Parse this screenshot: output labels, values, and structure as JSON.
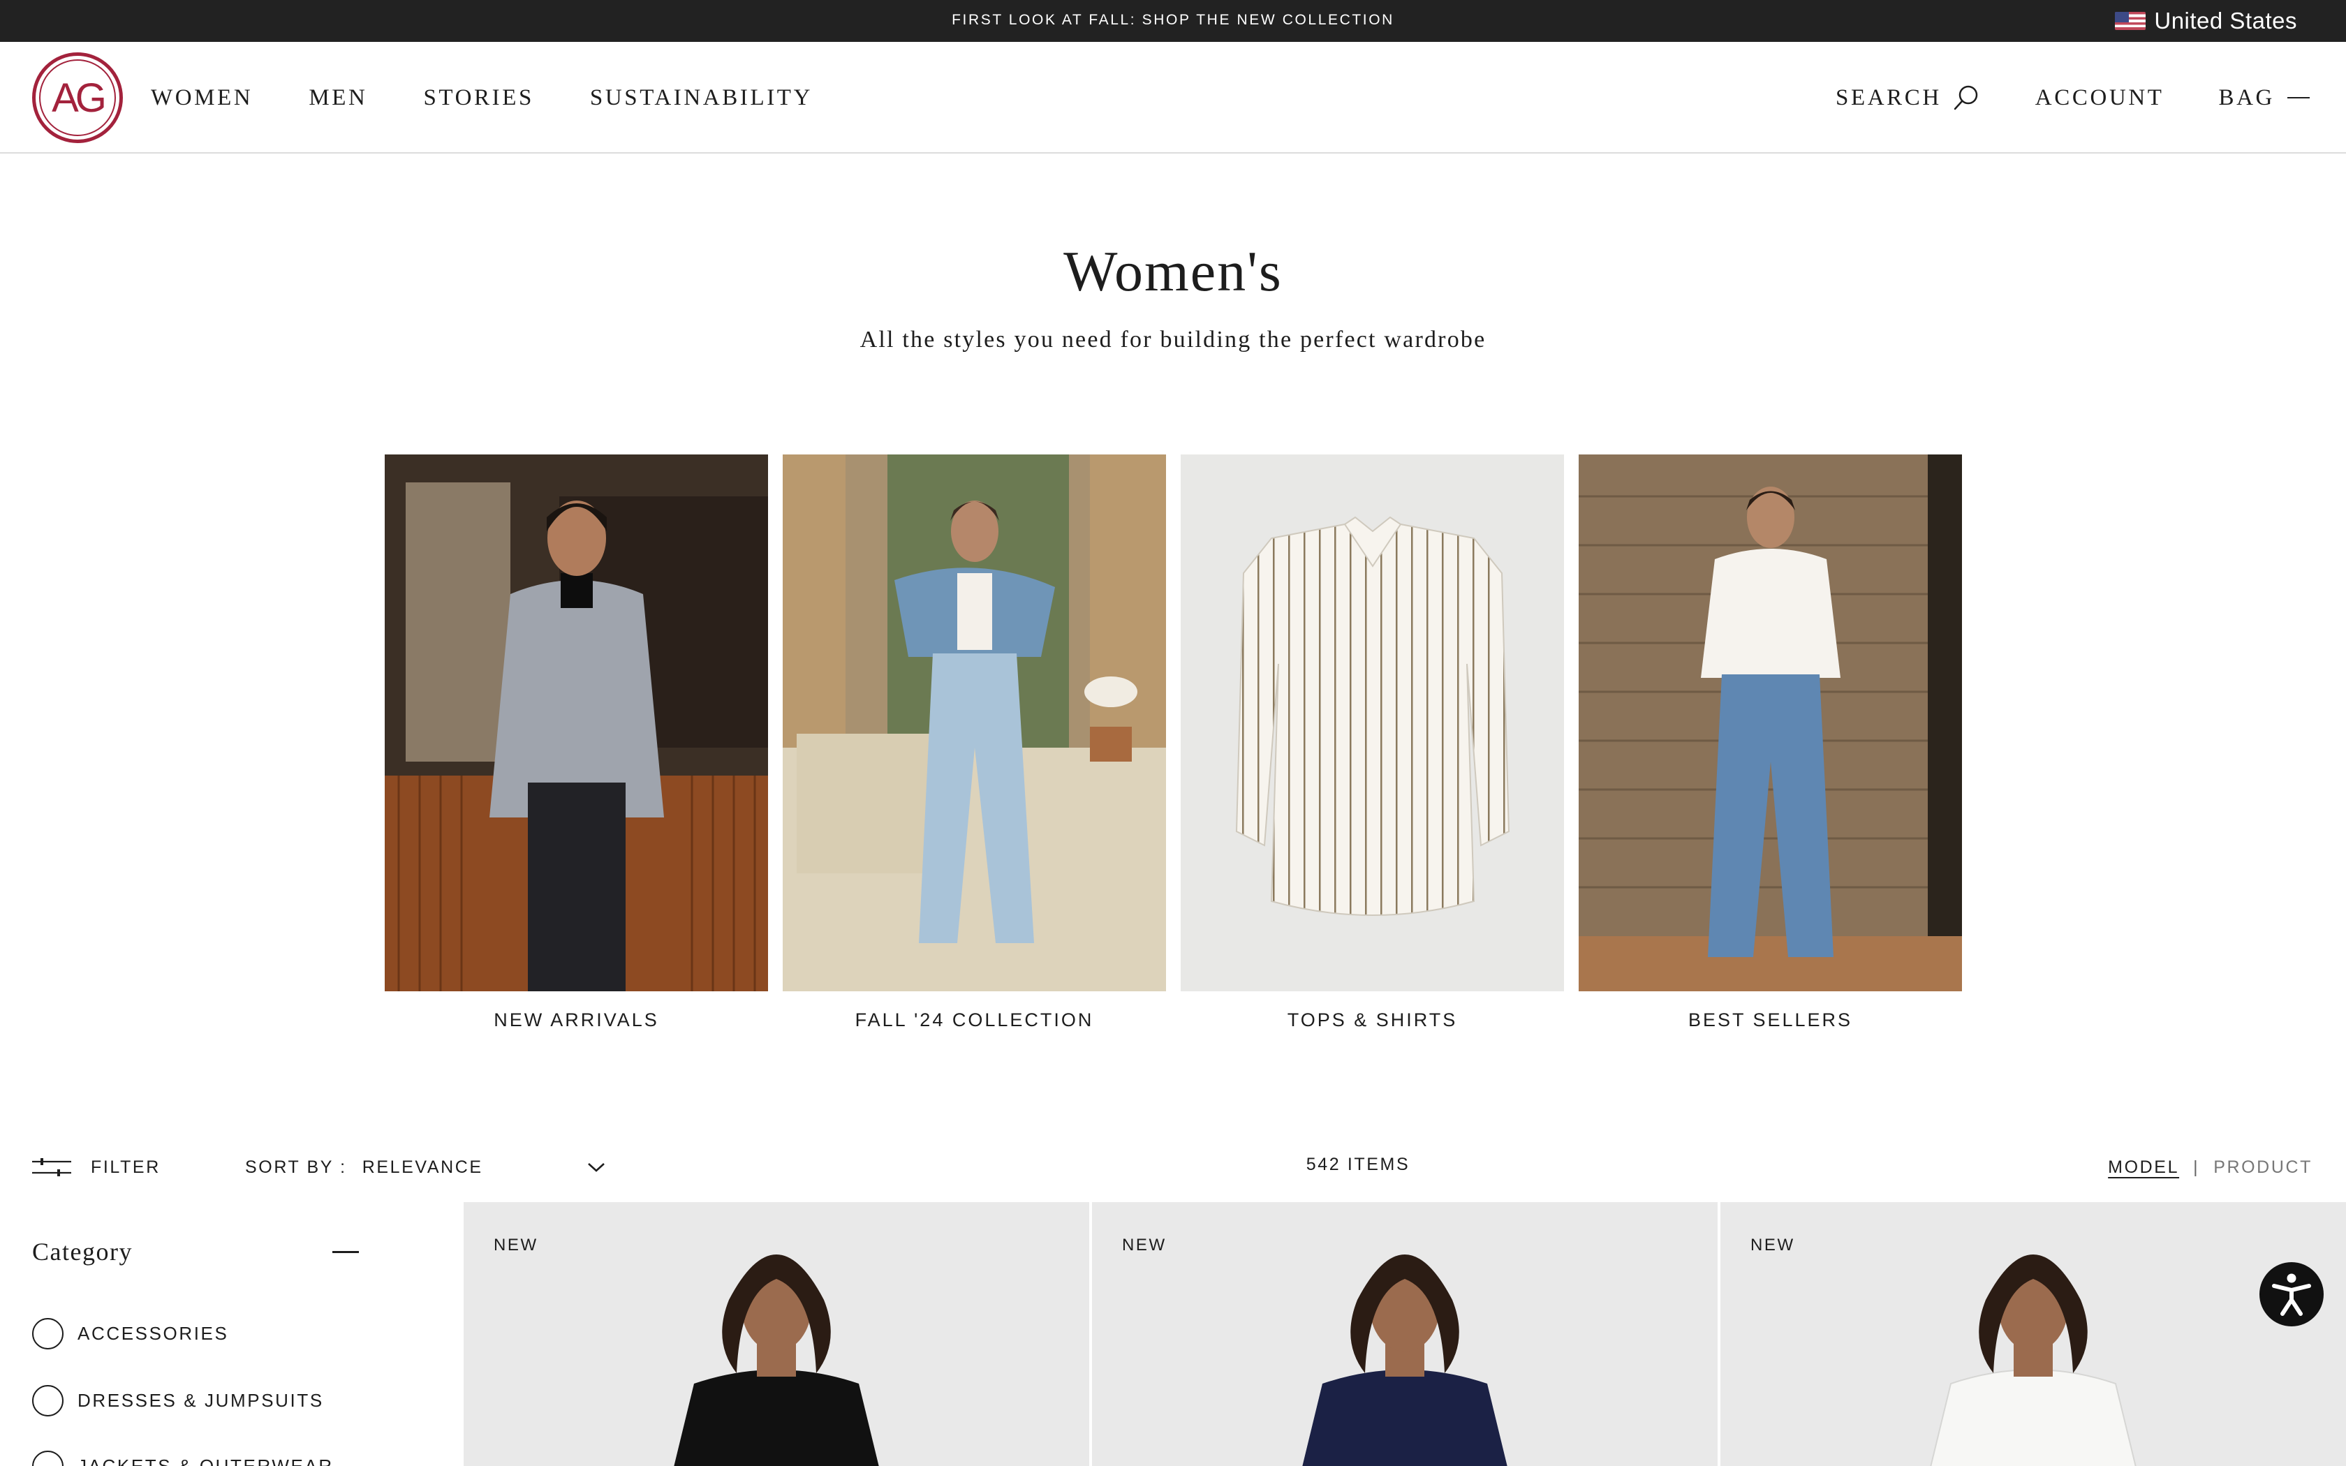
{
  "announcement": {
    "text": "FIRST LOOK AT FALL: SHOP THE NEW COLLECTION",
    "region": "United States",
    "flag_icon": "us-flag-icon"
  },
  "header": {
    "logo": "AG",
    "nav": [
      "WOMEN",
      "MEN",
      "STORIES",
      "SUSTAINABILITY"
    ],
    "search": "SEARCH",
    "account": "ACCOUNT",
    "bag": "BAG",
    "brand_color": "#a3223c"
  },
  "hero": {
    "title": "Women's",
    "subtitle": "All the styles you need for building the perfect wardrobe"
  },
  "categories": [
    {
      "label": "NEW ARRIVALS"
    },
    {
      "label": "FALL '24 COLLECTION"
    },
    {
      "label": "TOPS & SHIRTS"
    },
    {
      "label": "BEST SELLERS"
    }
  ],
  "toolbar": {
    "filter": "FILTER",
    "sort_label": "SORT BY :",
    "sort_value": "RELEVANCE",
    "item_count": "542 ITEMS",
    "view_model": "MODEL",
    "view_separator": "|",
    "view_product": "PRODUCT"
  },
  "sidebar": {
    "category_title": "Category",
    "items": [
      "ACCESSORIES",
      "DRESSES & JUMPSUITS",
      "JACKETS & OUTERWEAR"
    ]
  },
  "products": [
    {
      "badge": "NEW",
      "shirt_color": "#111111"
    },
    {
      "badge": "NEW",
      "shirt_color": "#1b2145"
    },
    {
      "badge": "NEW",
      "shirt_color": "#f4f4f2"
    }
  ]
}
